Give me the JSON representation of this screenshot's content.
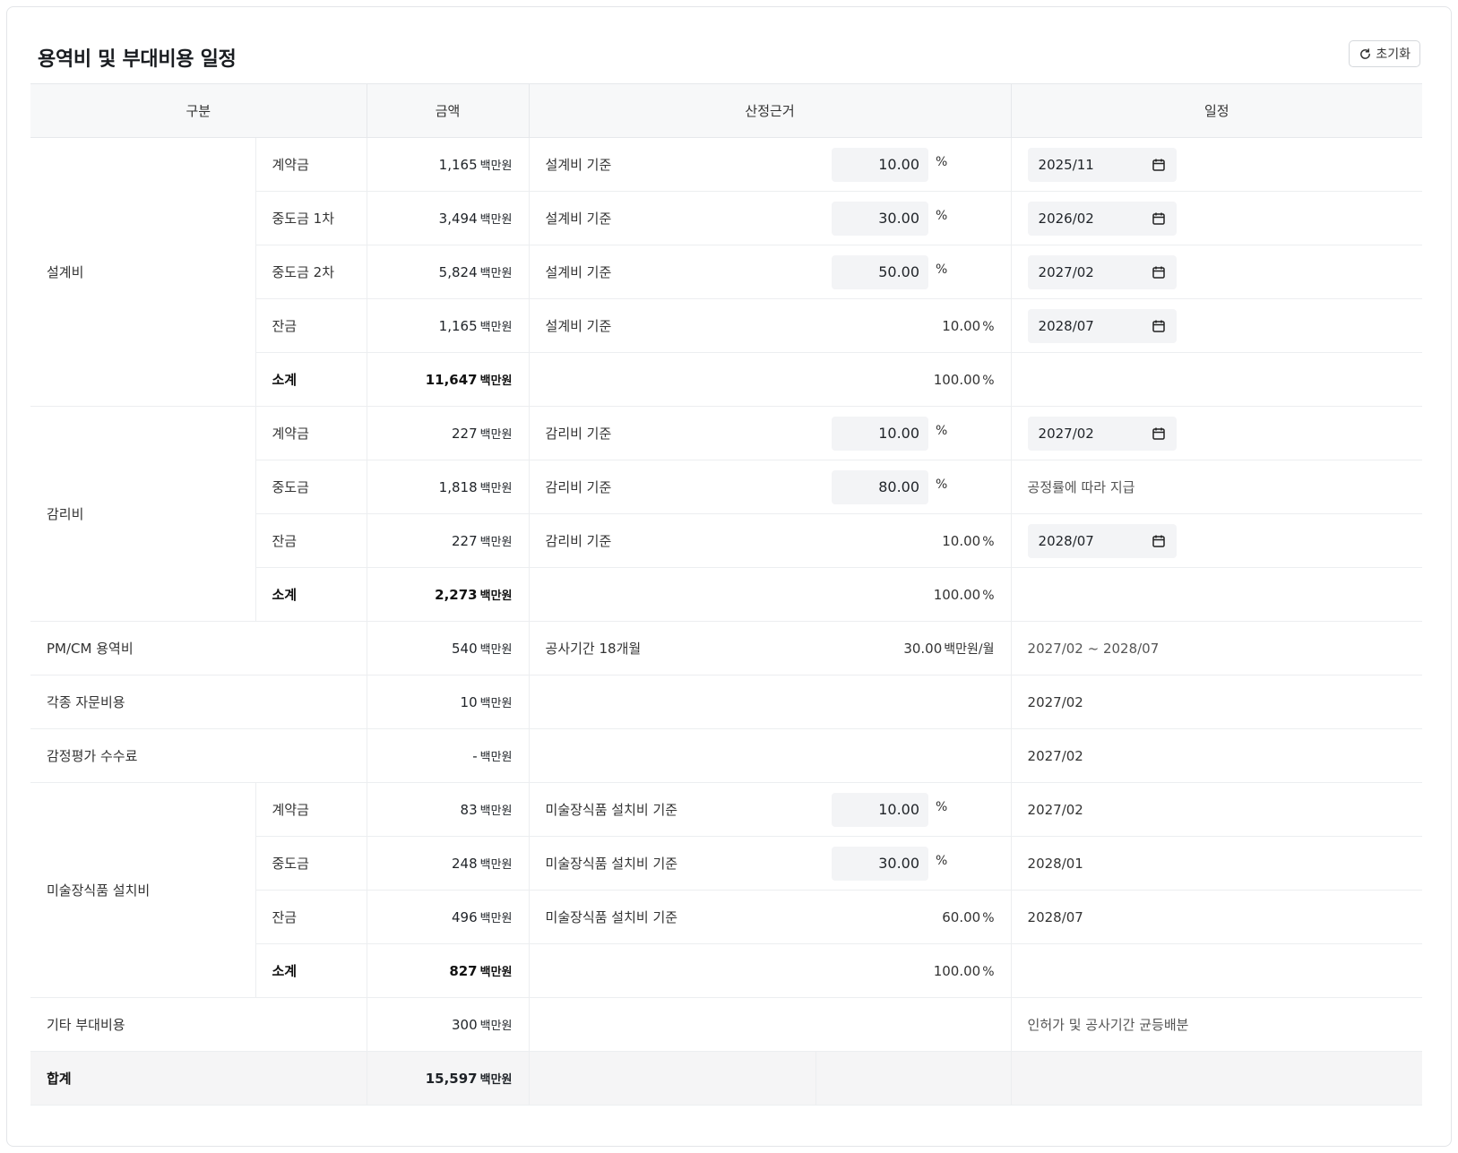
{
  "title": "용역비 및 부대비용 일정",
  "reset_label": "초기화",
  "headers": {
    "category": "구분",
    "amount": "금액",
    "basis": "산정근거",
    "schedule": "일정"
  },
  "unit": "백만원",
  "percent_sign": "%",
  "design": {
    "label": "설계비",
    "rows": [
      {
        "label": "계약금",
        "amount": "1,165",
        "basis": "설계비 기준",
        "percent": "10.00",
        "date": "2025/11"
      },
      {
        "label": "중도금 1차",
        "amount": "3,494",
        "basis": "설계비 기준",
        "percent": "30.00",
        "date": "2026/02"
      },
      {
        "label": "중도금 2차",
        "amount": "5,824",
        "basis": "설계비 기준",
        "percent": "50.00",
        "date": "2027/02"
      },
      {
        "label": "잔금",
        "amount": "1,165",
        "basis": "설계비 기준",
        "percent": "10.00",
        "date": "2028/07"
      }
    ],
    "subtotal": {
      "label": "소계",
      "amount": "11,647",
      "percent": "100.00"
    }
  },
  "supervision": {
    "label": "감리비",
    "rows": [
      {
        "label": "계약금",
        "amount": "227",
        "basis": "감리비 기준",
        "percent": "10.00",
        "date": "2027/02"
      },
      {
        "label": "중도금",
        "amount": "1,818",
        "basis": "감리비 기준",
        "percent": "80.00",
        "schedule_text": "공정률에 따라 지급"
      },
      {
        "label": "잔금",
        "amount": "227",
        "basis": "감리비 기준",
        "percent": "10.00",
        "date": "2028/07"
      }
    ],
    "subtotal": {
      "label": "소계",
      "amount": "2,273",
      "percent": "100.00"
    }
  },
  "pmcm": {
    "label": "PM/CM 용역비",
    "amount": "540",
    "basis": "공사기간 18개월",
    "rate": "30.00",
    "rate_unit": "백만원/월",
    "schedule": "2027/02 ~ 2028/07"
  },
  "consulting": {
    "label": "각종 자문비용",
    "amount": "10",
    "schedule": "2027/02"
  },
  "appraisal": {
    "label": "감정평가 수수료",
    "amount": "-",
    "schedule": "2027/02"
  },
  "art": {
    "label": "미술장식품 설치비",
    "rows": [
      {
        "label": "계약금",
        "amount": "83",
        "basis": "미술장식품 설치비 기준",
        "percent": "10.00",
        "schedule": "2027/02"
      },
      {
        "label": "중도금",
        "amount": "248",
        "basis": "미술장식품 설치비 기준",
        "percent": "30.00",
        "schedule": "2028/01"
      },
      {
        "label": "잔금",
        "amount": "496",
        "basis": "미술장식품 설치비 기준",
        "percent": "60.00",
        "schedule": "2028/07"
      }
    ],
    "subtotal": {
      "label": "소계",
      "amount": "827",
      "percent": "100.00"
    }
  },
  "other": {
    "label": "기타 부대비용",
    "amount": "300",
    "schedule": "인허가 및 공사기간 균등배분"
  },
  "total": {
    "label": "합계",
    "amount": "15,597"
  },
  "icons": {
    "reset": "refresh-icon",
    "calendar": "calendar-icon"
  }
}
